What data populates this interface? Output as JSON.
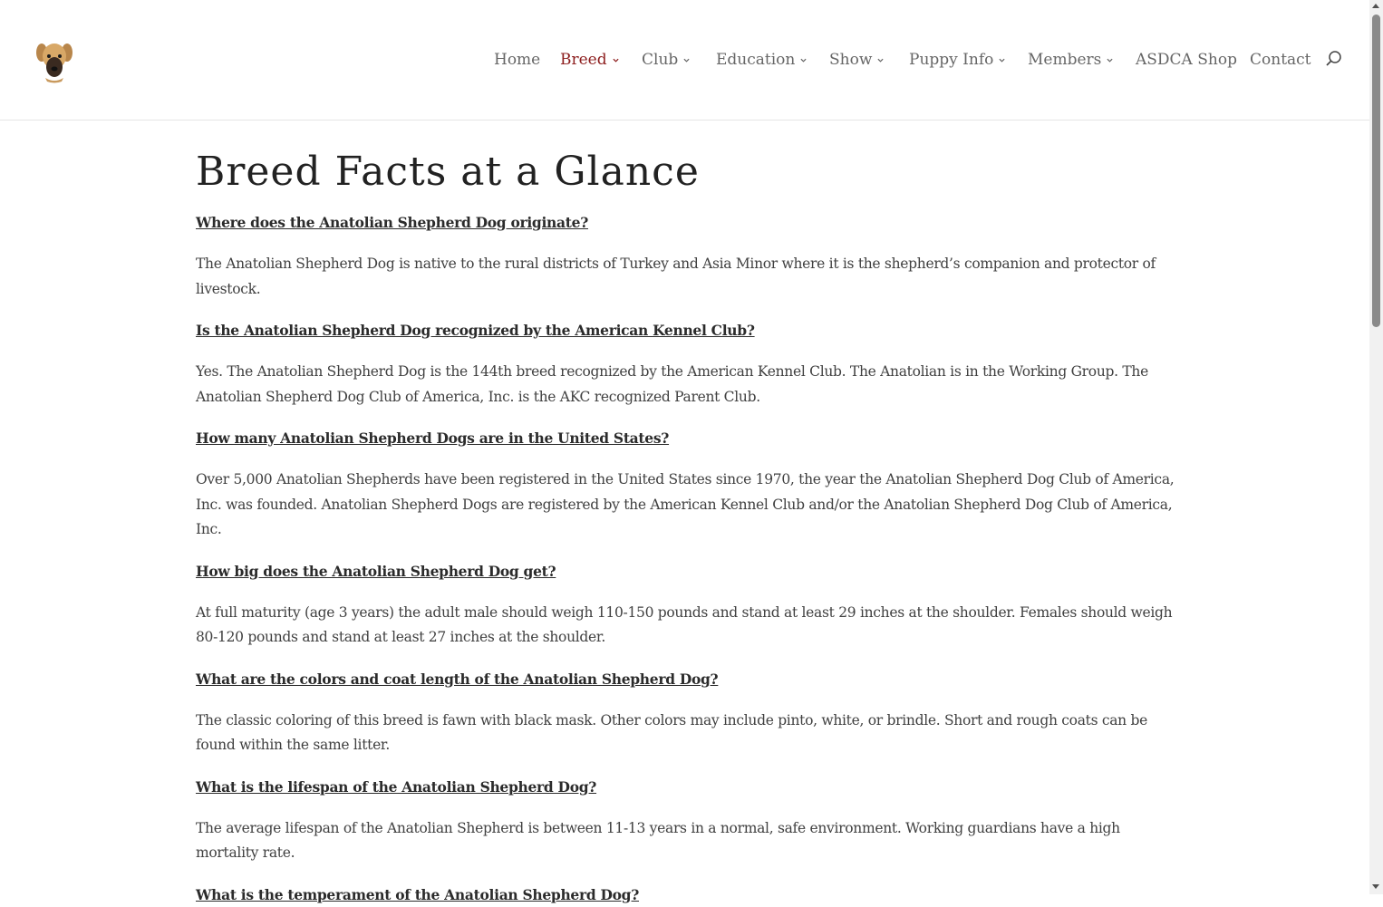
{
  "header": {
    "logo_icon": "anatolian-shepherd-dog-head-icon",
    "nav": [
      {
        "label": "Home",
        "has_dropdown": false,
        "active": false
      },
      {
        "label": "Breed",
        "has_dropdown": true,
        "active": true
      },
      {
        "label": "Club",
        "has_dropdown": true,
        "active": false
      },
      {
        "label": "Education",
        "has_dropdown": true,
        "active": false
      },
      {
        "label": "Show",
        "has_dropdown": true,
        "active": false
      },
      {
        "label": "Puppy Info",
        "has_dropdown": true,
        "active": false
      },
      {
        "label": "Members",
        "has_dropdown": true,
        "active": false
      },
      {
        "label": "ASDCA Shop",
        "has_dropdown": false,
        "active": false
      },
      {
        "label": "Contact",
        "has_dropdown": false,
        "active": false
      }
    ],
    "search_icon": "search-icon",
    "active_color": "#8c1c1c",
    "nav_color": "#666666"
  },
  "main": {
    "title": "Breed Facts at a Glance",
    "faq": [
      {
        "question": "Where does the Anatolian Shepherd Dog originate?",
        "answer": "The Anatolian Shepherd Dog is native to the rural districts of Turkey and Asia Minor where it is the shepherd’s companion and protector of livestock."
      },
      {
        "question": "Is the Anatolian Shepherd Dog recognized by the American Kennel Club?",
        "answer": "Yes. The Anatolian Shepherd Dog is the 144th breed recognized by the American Kennel Club. The Anatolian is in the Working Group. The Anatolian Shepherd Dog Club of America, Inc. is the AKC recognized Parent Club."
      },
      {
        "question": "How many Anatolian Shepherd Dogs are in the United States?",
        "answer": "Over 5,000 Anatolian Shepherds have been registered in the United States since 1970, the year the Anatolian Shepherd Dog Club of America, Inc. was founded. Anatolian Shepherd Dogs are registered by the American Kennel Club and/or the Anatolian Shepherd Dog Club of America, Inc."
      },
      {
        "question": "How big does the Anatolian Shepherd Dog get?",
        "answer": "At full maturity (age 3 years) the adult male should weigh 110-150 pounds and stand at least 29 inches at the shoulder. Females should weigh 80-120 pounds and stand at least 27 inches at the shoulder."
      },
      {
        "question": "What are the colors and coat length of the Anatolian Shepherd Dog?",
        "answer": "The classic coloring of this breed is fawn with black mask. Other colors may include pinto, white, or brindle. Short and rough coats can be found within the same litter."
      },
      {
        "question": "What is the lifespan of the Anatolian Shepherd Dog?",
        "answer": "The average lifespan of the Anatolian Shepherd is between 11-13 years in a normal, safe environment. Working guardians have a high mortality rate."
      },
      {
        "question": "What is the temperament of the Anatolian Shepherd Dog?",
        "answer": ""
      }
    ]
  }
}
